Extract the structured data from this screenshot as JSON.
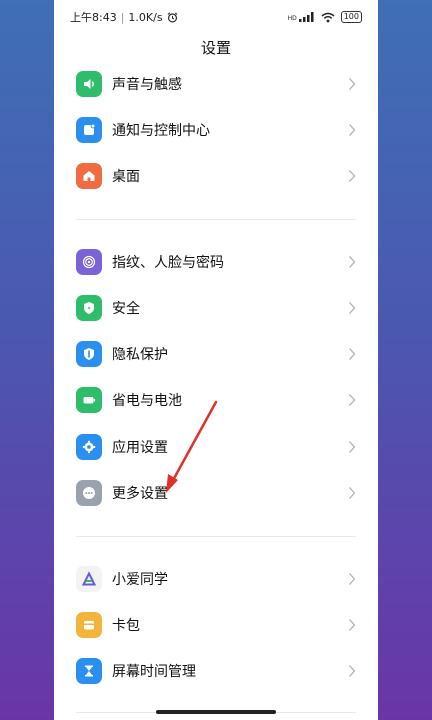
{
  "status_bar": {
    "time": "上午8:43",
    "speed": "1.0K/s",
    "alarm_icon": "alarm-icon",
    "signal_icon": "signal-icon",
    "signal_label": "HD",
    "wifi_icon": "wifi-icon",
    "battery": "100"
  },
  "page": {
    "title": "设置"
  },
  "groups": [
    {
      "items": [
        {
          "label": "声音与触感",
          "icon": "sound-icon",
          "color": "#2ebd6b"
        },
        {
          "label": "通知与控制中心",
          "icon": "notification-icon",
          "color": "#2b8ff0"
        },
        {
          "label": "桌面",
          "icon": "home-icon",
          "color": "#f06b42"
        }
      ]
    },
    {
      "items": [
        {
          "label": "指纹、人脸与密码",
          "icon": "fingerprint-icon",
          "color": "#7b62d6"
        },
        {
          "label": "安全",
          "icon": "shield-icon",
          "color": "#2ebd6b"
        },
        {
          "label": "隐私保护",
          "icon": "privacy-icon",
          "color": "#2b8ff0"
        },
        {
          "label": "省电与电池",
          "icon": "battery-icon",
          "color": "#2ebd6b"
        },
        {
          "label": "应用设置",
          "icon": "gear-icon",
          "color": "#2b8ff0"
        },
        {
          "label": "更多设置",
          "icon": "more-icon",
          "color": "#9aa3ad"
        }
      ]
    },
    {
      "items": [
        {
          "label": "小爱同学",
          "icon": "assistant-icon",
          "color": "#f3f3f3"
        },
        {
          "label": "卡包",
          "icon": "wallet-icon",
          "color": "#f2b43a"
        },
        {
          "label": "屏幕时间管理",
          "icon": "hourglass-icon",
          "color": "#2b8ff0"
        }
      ]
    }
  ],
  "annotation": {
    "arrow_color": "#e0302a"
  }
}
